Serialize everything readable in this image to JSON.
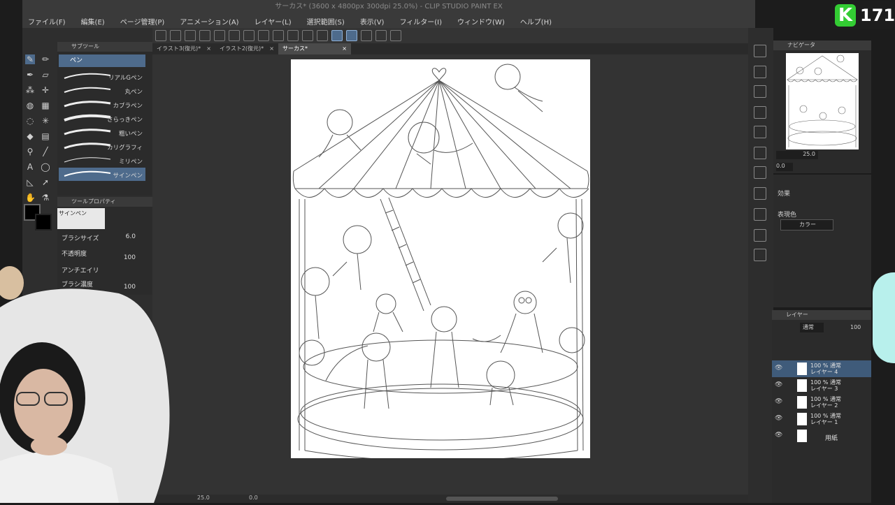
{
  "app": {
    "window_title": "サーカス* (3600 x 4800px 300dpi 25.0%)  - CLIP STUDIO PAINT EX"
  },
  "menu": [
    "ファイル(F)",
    "編集(E)",
    "ページ管理(P)",
    "アニメーション(A)",
    "レイヤー(L)",
    "選択範囲(S)",
    "表示(V)",
    "フィルター(I)",
    "ウィンドウ(W)",
    "ヘルプ(H)"
  ],
  "tabs": [
    {
      "label": "イラスト3(復元)*",
      "close": "×"
    },
    {
      "label": "イラスト2(復元)*",
      "close": "×"
    },
    {
      "label": "サーカス*",
      "close": "×",
      "active": true
    }
  ],
  "subtool": {
    "header": "サブツール",
    "group_label": "ペン",
    "brushes": [
      "リアルGペン",
      "丸ペン",
      "カブラペン",
      "さらっきペン",
      "粗いペン",
      "カリグラフィ",
      "ミリペン",
      "サインペン"
    ]
  },
  "tool_property": {
    "header": "ツールプロパティ",
    "brush_name": "サインペン",
    "brush_size_label": "ブラシサイズ",
    "brush_size_value": "6.0",
    "opacity_label": "不透明度",
    "opacity_value": "100",
    "antialias_label": "アンチエイリ",
    "density_label": "ブラシ濃度",
    "density_value": "100"
  },
  "navigator": {
    "header": "ナビゲータ",
    "zoom": "25.0",
    "rotation": "0.0"
  },
  "properties": {
    "effect_label": "効果",
    "expression_color_label": "表現色",
    "color_value": "カラー"
  },
  "layers": {
    "header": "レイヤー",
    "blend_mode": "通常",
    "opacity": "100",
    "items": [
      {
        "line1": "100 % 通常",
        "line2": "レイヤー 4",
        "selected": true
      },
      {
        "line1": "100 % 通常",
        "line2": "レイヤー 3"
      },
      {
        "line1": "100 % 通常",
        "line2": "レイヤー 2"
      },
      {
        "line1": "100 % 通常",
        "line2": "レイヤー 1"
      },
      {
        "line1": "用紙",
        "line2": ""
      }
    ]
  },
  "statusbar": {
    "zoom": "25.0",
    "rotation": "0.0"
  },
  "stream_badge": {
    "letter": "K",
    "count": "171"
  },
  "colors": {
    "accent_selected": "#3f5b7a",
    "badge_green": "#33cc33",
    "ui_dark": "#2e2e2e"
  }
}
